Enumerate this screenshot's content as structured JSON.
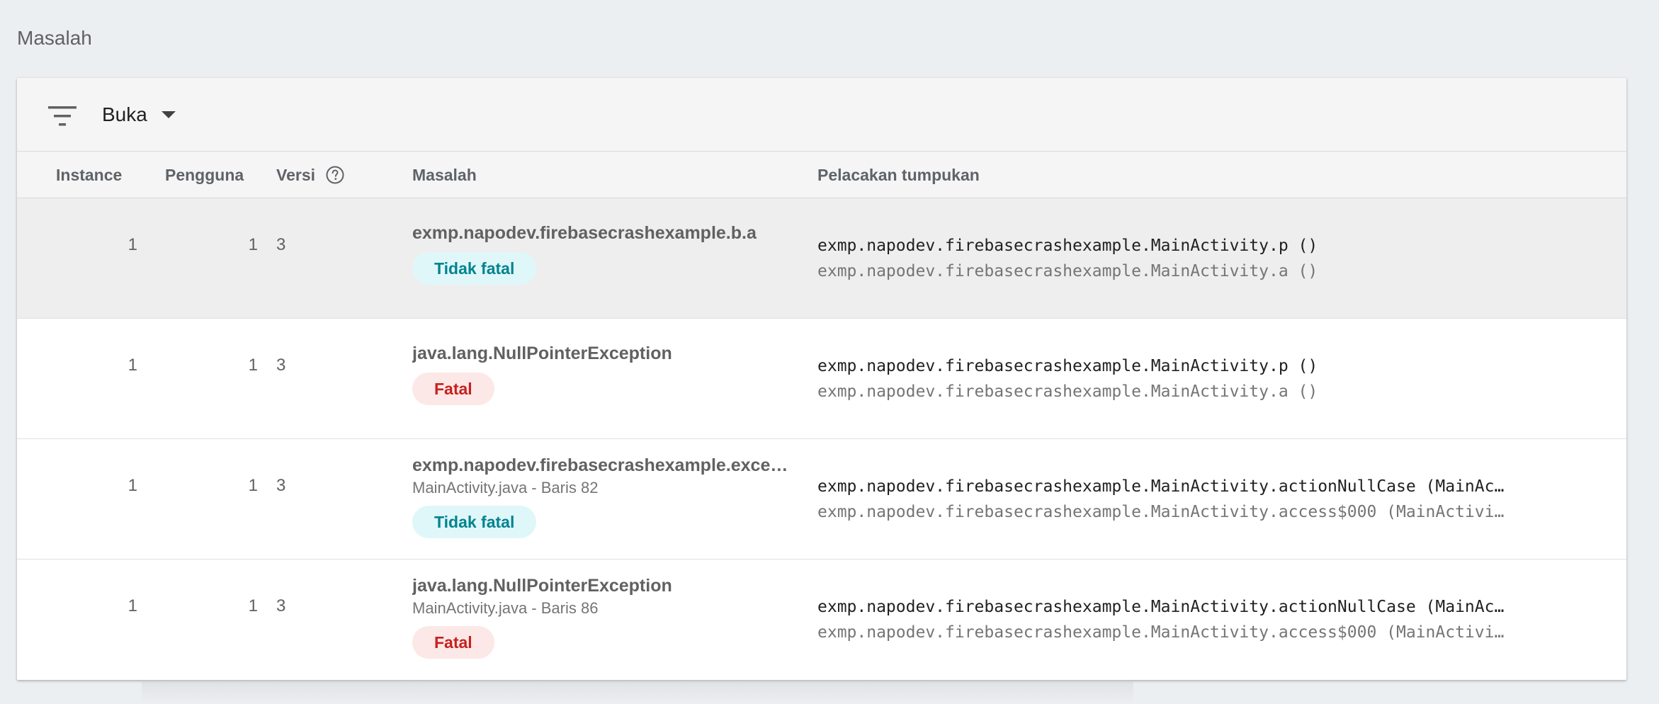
{
  "section": {
    "title": "Masalah"
  },
  "toolbar": {
    "filter_icon": "filter-list-icon",
    "filter_value": "Buka",
    "dropdown_icon": "arrow-drop-down-icon"
  },
  "table": {
    "headers": {
      "instances": "Instance",
      "users": "Pengguna",
      "version": "Versi",
      "version_help_icon": "help-circle-icon",
      "issue": "Masalah",
      "stack": "Pelacakan tumpukan"
    },
    "rows": [
      {
        "instances": "1",
        "users": "1",
        "version": "3",
        "issue_title": "exmp.napodev.firebasecrashexample.b.a",
        "issue_sub": "",
        "badge": "Tidak fatal",
        "badge_type": "nonfatal",
        "stack_line1": "exmp.napodev.firebasecrashexample.MainActivity.p ()",
        "stack_line2": "exmp.napodev.firebasecrashexample.MainActivity.a ()",
        "hovered": true
      },
      {
        "instances": "1",
        "users": "1",
        "version": "3",
        "issue_title": "java.lang.NullPointerException",
        "issue_sub": "",
        "badge": "Fatal",
        "badge_type": "fatal",
        "stack_line1": "exmp.napodev.firebasecrashexample.MainActivity.p ()",
        "stack_line2": "exmp.napodev.firebasecrashexample.MainActivity.a ()",
        "hovered": false
      },
      {
        "instances": "1",
        "users": "1",
        "version": "3",
        "issue_title": "exmp.napodev.firebasecrashexample.exce…",
        "issue_sub": "MainActivity.java - Baris 82",
        "badge": "Tidak fatal",
        "badge_type": "nonfatal",
        "stack_line1": "exmp.napodev.firebasecrashexample.MainActivity.actionNullCase (MainAc…",
        "stack_line2": "exmp.napodev.firebasecrashexample.MainActivity.access$000 (MainActivi…",
        "hovered": false
      },
      {
        "instances": "1",
        "users": "1",
        "version": "3",
        "issue_title": "java.lang.NullPointerException",
        "issue_sub": "MainActivity.java - Baris 86",
        "badge": "Fatal",
        "badge_type": "fatal",
        "stack_line1": "exmp.napodev.firebasecrashexample.MainActivity.actionNullCase (MainAc…",
        "stack_line2": "exmp.napodev.firebasecrashexample.MainActivity.access$000 (MainActivi…",
        "hovered": false
      }
    ]
  },
  "colors": {
    "page_bg": "#eceff1",
    "nonfatal_bg": "#e0f7fa",
    "nonfatal_text": "#00838f",
    "fatal_bg": "#fce8e6",
    "fatal_text": "#c5221f"
  }
}
